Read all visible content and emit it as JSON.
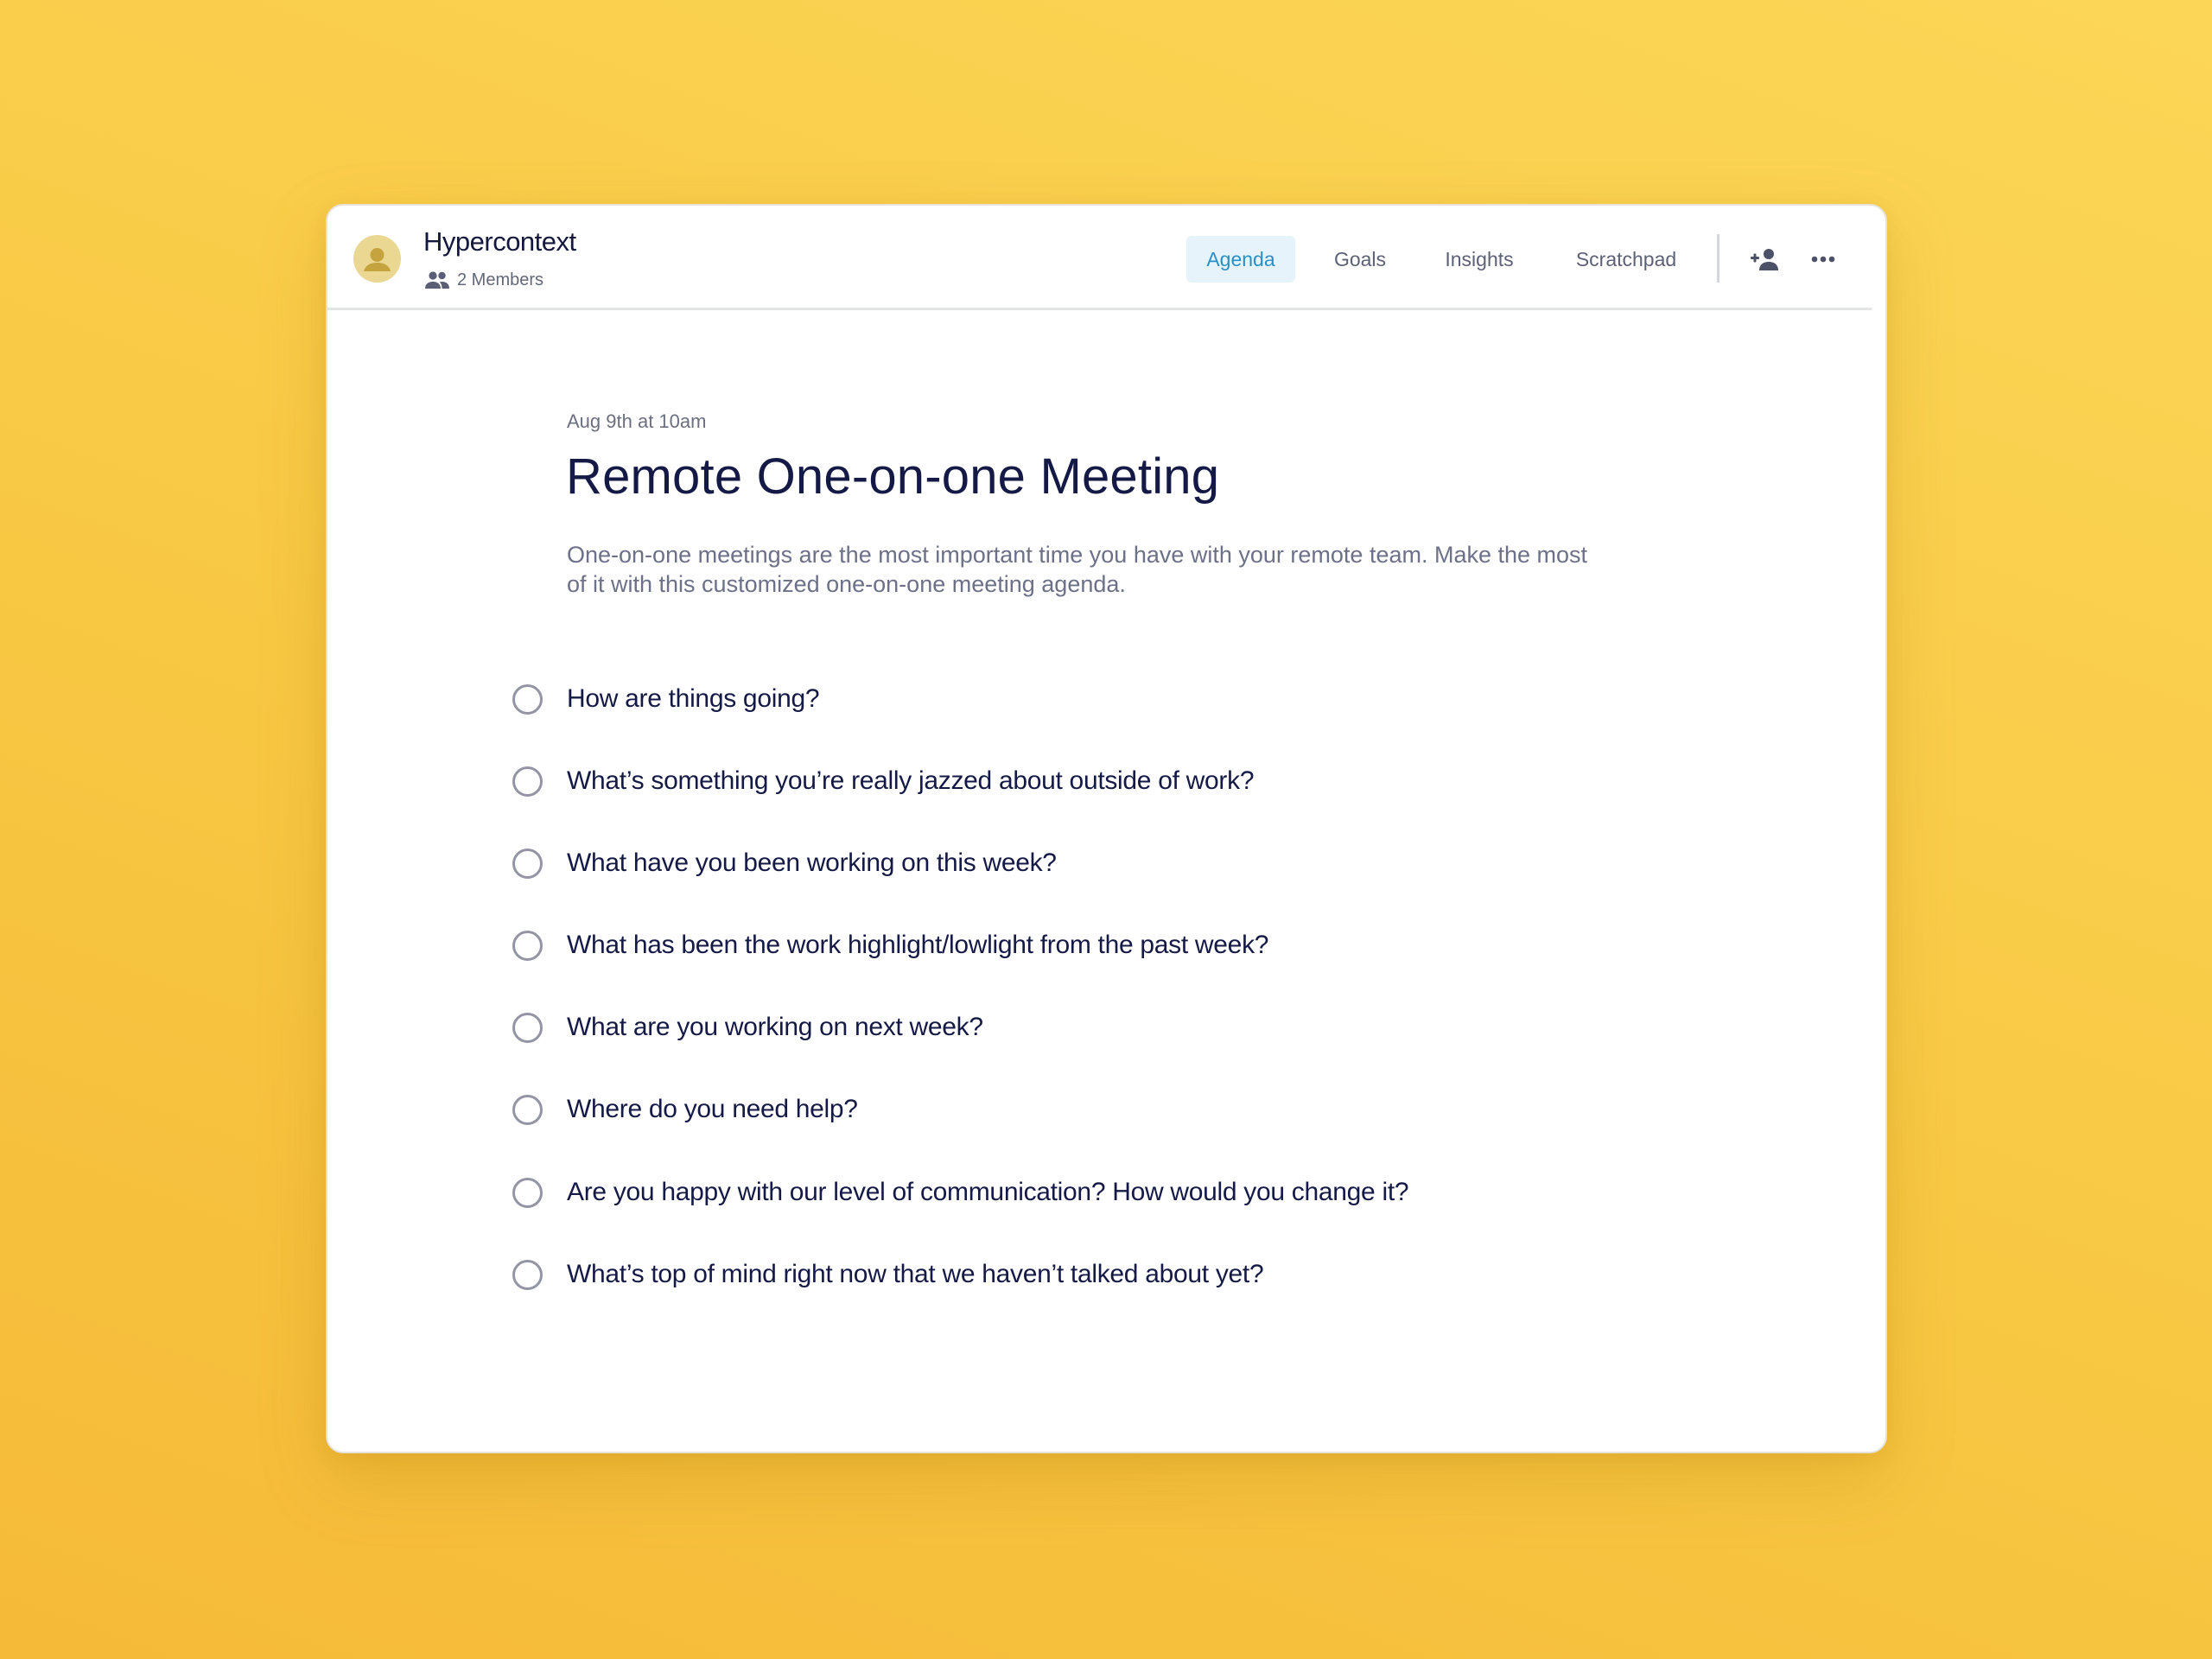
{
  "header": {
    "workspace_title": "Hypercontext",
    "members_label": "2 Members",
    "avatar_icon": "user-avatar-icon",
    "members_icon": "group-icon",
    "tabs": [
      {
        "label": "Agenda",
        "active": true
      },
      {
        "label": "Goals",
        "active": false
      },
      {
        "label": "Insights",
        "active": false
      },
      {
        "label": "Scratchpad",
        "active": false
      }
    ],
    "actions": {
      "add_member_icon": "add-person-icon",
      "more_icon": "more-horizontal-icon"
    }
  },
  "meeting": {
    "date": "Aug 9th at 10am",
    "title": "Remote One-on-one Meeting",
    "description": "One-on-one meetings are the most important time you have with your remote team. Make the most of it with this customized one-on-one meeting agenda."
  },
  "agenda_items": [
    {
      "text": "How are things going?",
      "checked": false
    },
    {
      "text": "What’s something you’re really jazzed about outside of work?",
      "checked": false
    },
    {
      "text": "What have you been working on this week?",
      "checked": false
    },
    {
      "text": "What has been the work highlight/lowlight from the past week?",
      "checked": false
    },
    {
      "text": "What are you working on next week?",
      "checked": false
    },
    {
      "text": "Where do you need help?",
      "checked": false
    },
    {
      "text": "Are you happy with our level of communication? How would you change it?",
      "checked": false
    },
    {
      "text": "What’s top of mind right now that we haven’t talked about yet?",
      "checked": false
    }
  ],
  "colors": {
    "background": "#f8c843",
    "active_tab_bg": "#e6f3fa",
    "active_tab_text": "#2a8fc4",
    "heading_text": "#141a45",
    "muted_text": "#6c7088",
    "checkbox_border": "#9395a5",
    "avatar_bg": "#ead892"
  }
}
